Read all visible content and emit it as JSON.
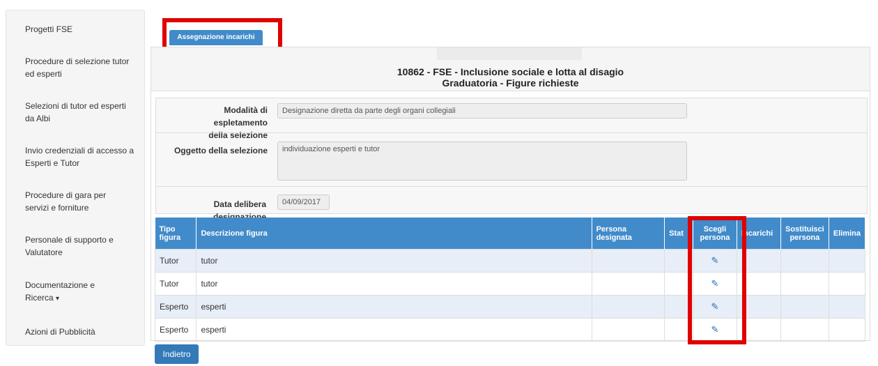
{
  "sidebar": {
    "items": [
      {
        "label": "Progetti FSE"
      },
      {
        "label": "Procedure di selezione tutor ed esperti"
      },
      {
        "label": "Selezioni di tutor ed esperti da Albi"
      },
      {
        "label": "Invio credenziali di accesso a Esperti e Tutor"
      },
      {
        "label": "Procedure di gara per servizi e forniture"
      },
      {
        "label": "Personale di supporto e Valutatore"
      },
      {
        "label": "Documentazione e Ricerca",
        "caret": "▾"
      },
      {
        "label": "Azioni di Pubblicità"
      }
    ]
  },
  "tab": {
    "label": "Assegnazione incarichi"
  },
  "panel": {
    "title": "10862 - FSE - Inclusione sociale e lotta al disagio",
    "subtitle": "Graduatoria - Figure richieste"
  },
  "form": {
    "modalita_label_1": "Modalità di espletamento",
    "modalita_label_2": "della selezione",
    "modalita_value": "Designazione diretta da parte degli organi collegiali",
    "oggetto_label": "Oggetto della selezione",
    "oggetto_value": "individuazione esperti e tutor",
    "data_label": "Data delibera designazione",
    "data_value": "04/09/2017"
  },
  "table": {
    "headers": {
      "tipo_1": "Tipo",
      "tipo_2": "figura",
      "descr": "Descrizione figura",
      "persona_1": "Persona",
      "persona_2": "designata",
      "stato": "Stat",
      "scegli_1": "Scegli",
      "scegli_2": "persona",
      "incarichi": "Incarichi",
      "sost_1": "Sostituisci",
      "sost_2": "persona",
      "elimina": "Elimina"
    },
    "rows": [
      {
        "tipo": "Tutor",
        "descr": "tutor"
      },
      {
        "tipo": "Tutor",
        "descr": "tutor"
      },
      {
        "tipo": "Esperto",
        "descr": "esperti"
      },
      {
        "tipo": "Esperto",
        "descr": "esperti"
      }
    ]
  },
  "buttons": {
    "back": "Indietro"
  },
  "colors": {
    "accent": "#428bca",
    "highlight": "#e00000"
  },
  "icons": {
    "edit": "pencil-icon"
  }
}
